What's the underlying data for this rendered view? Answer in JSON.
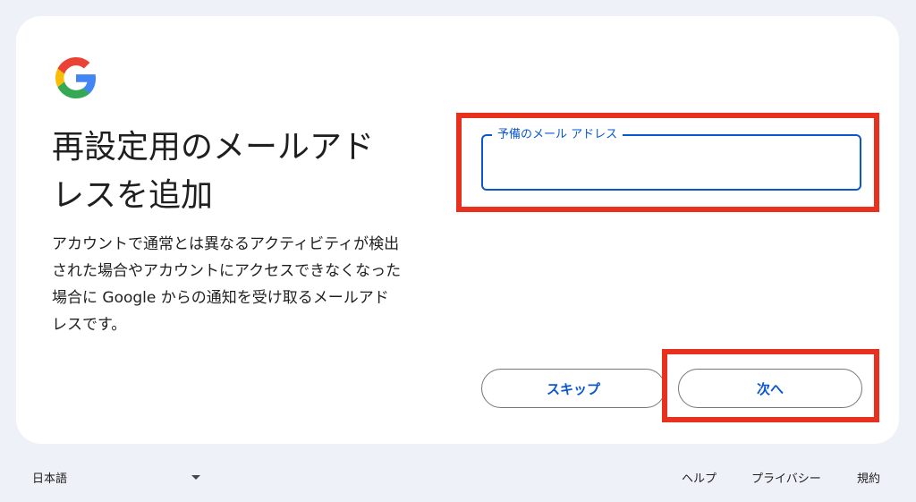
{
  "page": {
    "title_line1": "再設定用のメールアド",
    "title_line2": "レスを追加",
    "description_line1": "アカウントで通常とは異なるアクティビティが検出",
    "description_line2": "された場合やアカウントにアクセスできなくなった",
    "description_line3": "場合に Google からの通知を受け取るメールアド",
    "description_line4": "レスです。"
  },
  "form": {
    "email_label": "予備のメール アドレス",
    "email_value": ""
  },
  "buttons": {
    "skip_label": "スキップ",
    "next_label": "次へ"
  },
  "footer": {
    "language": "日本語",
    "help": "ヘルプ",
    "privacy": "プライバシー",
    "terms": "規約"
  },
  "colors": {
    "accent": "#0b57d0",
    "highlight": "#e8301f",
    "background": "#eef1f7"
  },
  "icons": {
    "logo": "google-logo-icon",
    "language_caret": "caret-down-icon"
  }
}
